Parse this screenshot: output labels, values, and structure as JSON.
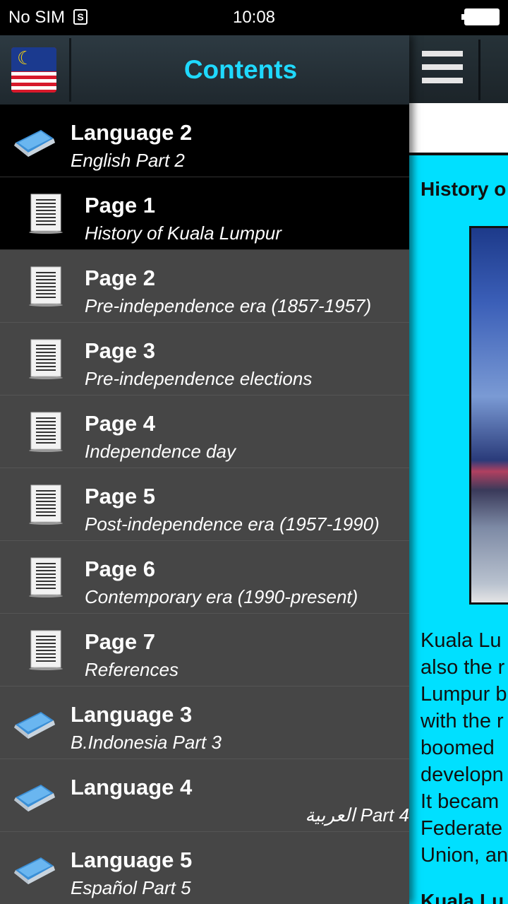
{
  "status_bar": {
    "carrier": "No SIM",
    "sim_badge": "S",
    "time": "10:08"
  },
  "drawer": {
    "title": "Contents",
    "items": [
      {
        "kind": "language",
        "title": "Language 2",
        "subtitle": "English Part 2",
        "selected_section": true
      },
      {
        "kind": "page",
        "title": "Page 1",
        "subtitle": "History of Kuala Lumpur",
        "active": true
      },
      {
        "kind": "page",
        "title": "Page 2",
        "subtitle": "Pre-independence era (1857-1957)"
      },
      {
        "kind": "page",
        "title": "Page 3",
        "subtitle": "Pre-independence elections"
      },
      {
        "kind": "page",
        "title": "Page 4",
        "subtitle": "Independence day"
      },
      {
        "kind": "page",
        "title": "Page 5",
        "subtitle": "Post-independence era (1957-1990)"
      },
      {
        "kind": "page",
        "title": "Page 6",
        "subtitle": "Contemporary era (1990-present)"
      },
      {
        "kind": "page",
        "title": "Page 7",
        "subtitle": "References"
      },
      {
        "kind": "language",
        "title": "Language 3",
        "subtitle": "B.Indonesia Part 3"
      },
      {
        "kind": "language",
        "title": "Language 4",
        "subtitle": "العربية Part 4",
        "rtl": true
      },
      {
        "kind": "language",
        "title": "Language 5",
        "subtitle": "Español Part 5"
      }
    ]
  },
  "content": {
    "page_title": "History o",
    "body_lines": [
      "Kuala Lu",
      "also the r",
      "Lumpur b",
      "with the r",
      "boomed",
      "developn",
      "It becam",
      "Federate",
      "Union, an"
    ],
    "next_heading": "Kuala Lu"
  },
  "colors": {
    "accent": "#1fd9ff",
    "content_bg": "#00e0ff",
    "drawer_bg": "#464646"
  },
  "icons": {
    "header": "malaysia-flag-icon",
    "menu": "hamburger-menu-icon",
    "language_item": "book-icon",
    "page_item": "document-icon"
  }
}
